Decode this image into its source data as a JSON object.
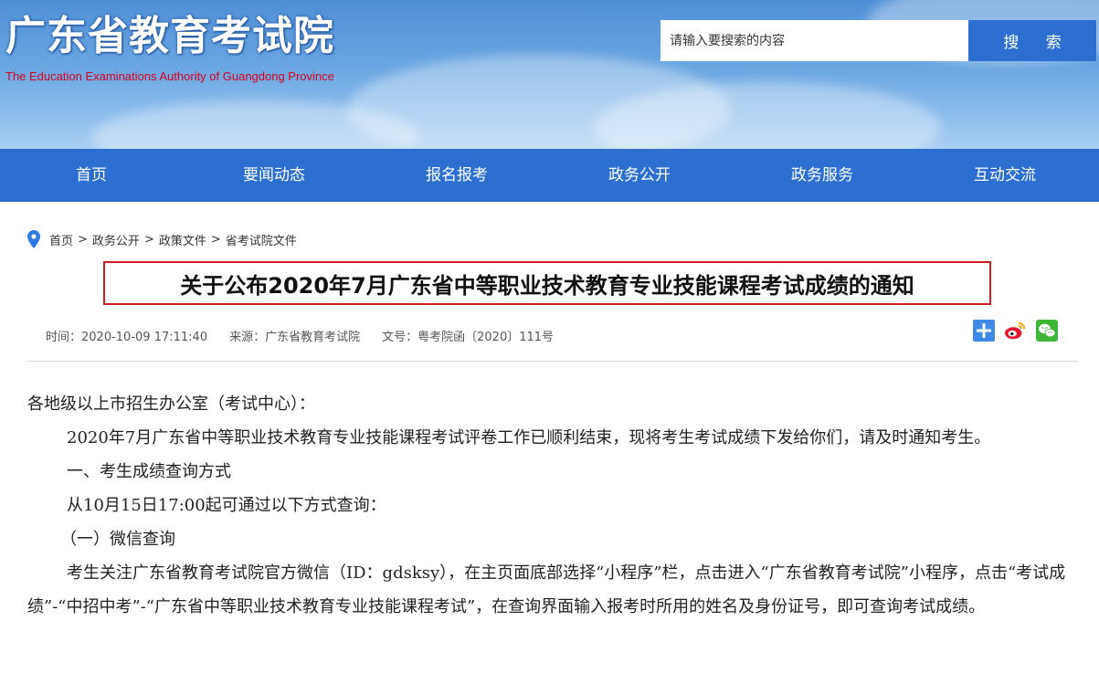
{
  "header": {
    "site_title": "广东省教育考试院",
    "site_subtitle": "The Education Examinations Authority of Guangdong Province",
    "search": {
      "placeholder": "请输入要搜索的内容",
      "button_label": "搜 索"
    }
  },
  "nav": {
    "items": [
      {
        "label": "首页"
      },
      {
        "label": "要闻动态"
      },
      {
        "label": "报名报考"
      },
      {
        "label": "政务公开"
      },
      {
        "label": "政务服务"
      },
      {
        "label": "互动交流"
      }
    ]
  },
  "breadcrumb": {
    "icon": "location-pin-icon",
    "items": [
      "首页",
      "政务公开",
      "政策文件",
      "省考试院文件"
    ],
    "separator": ">"
  },
  "article": {
    "title": "关于公布2020年7月广东省中等职业技术教育专业技能课程考试成绩的通知",
    "meta": {
      "time_label": "时间：",
      "time": "2020-10-09 17:11:40",
      "source_label": "来源：",
      "source": "广东省教育考试院",
      "doc_no_label": "文号：",
      "doc_no": "粤考院函〔2020〕111号"
    },
    "share_icons": [
      "share-plus-icon",
      "weibo-icon",
      "wechat-icon"
    ],
    "paragraphs": {
      "salutation": "各地级以上市招生办公室（考试中心）：",
      "p1": "2020年7月广东省中等职业技术教育专业技能课程考试评卷工作已顺利结束，现将考生考试成绩下发给你们，请及时通知考生。",
      "h1": "一、考生成绩查询方式",
      "p2": "从10月15日17:00起可通过以下方式查询：",
      "h2": "（一）微信查询",
      "p3": "考生关注广东省教育考试院官方微信（ID：gdsksy），在主页面底部选择“小程序”栏，点击进入“广东省教育考试院”小程序，点击“考试成绩”-“中招中考”-“广东省中等职业技术教育专业技能课程考试”，在查询界面输入报考时所用的姓名及身份证号，即可查询考试成绩。"
    }
  },
  "colors": {
    "nav_bg": "#2d6fd1",
    "title_border": "#d21e1e",
    "subtitle": "#d7001b",
    "banner_sky": "#6aa6e2"
  }
}
